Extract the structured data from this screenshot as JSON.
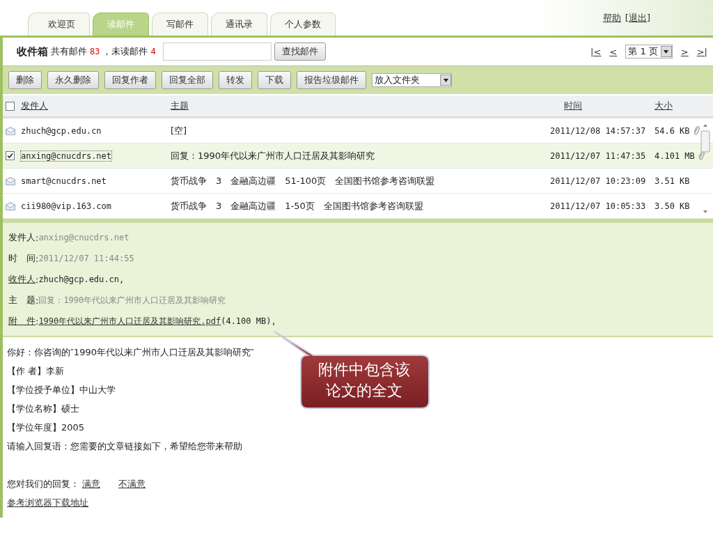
{
  "tabs": [
    {
      "label": "欢迎页",
      "selected": false
    },
    {
      "label": "读邮件",
      "selected": true
    },
    {
      "label": "写邮件",
      "selected": false
    },
    {
      "label": "通讯录",
      "selected": false
    },
    {
      "label": "个人参数",
      "selected": false
    }
  ],
  "top_links": {
    "help": "帮助",
    "logout": "[退出]"
  },
  "inbox": {
    "folder": "收件箱",
    "total_label": "共有邮件",
    "total": "83",
    "unread_label": "，未读邮件",
    "unread": "4",
    "search_button": "查找邮件"
  },
  "pager": {
    "first": "|<",
    "prev": "<",
    "page": "第 1 页",
    "next": ">",
    "last": ">|"
  },
  "toolbar": {
    "buttons": [
      "删除",
      "永久删除",
      "回复作者",
      "回复全部",
      "转发",
      "下载",
      "报告垃圾邮件"
    ],
    "folder_select": "放入文件夹"
  },
  "table": {
    "select_all": false,
    "columns": [
      "发件人",
      "主题",
      "时间",
      "大小"
    ],
    "rows": [
      {
        "sender": "zhuch@gcp.edu.cn",
        "subject": "[空]",
        "time": "2011/12/08 14:57:37",
        "size": "54.6 KB",
        "attachment": true,
        "selected": false
      },
      {
        "sender": "anxing@cnucdrs.net",
        "subject": "回复：1990年代以来广州市人口迁居及其影响研究",
        "time": "2011/12/07 11:47:35",
        "size": "4.101 MB",
        "attachment": true,
        "selected": true
      },
      {
        "sender": "smart@cnucdrs.net",
        "subject": "货币战争　3　金融高边疆　51-100页　全国图书馆参考咨询联盟",
        "time": "2011/12/07 10:23:09",
        "size": "3.51 KB",
        "attachment": false,
        "selected": false
      },
      {
        "sender": "cii980@vip.163.com",
        "subject": "货币战争　3　金融高边疆　1-50页　全国图书馆参考咨询联盟",
        "time": "2011/12/07 10:05:33",
        "size": "3.50 KB",
        "attachment": false,
        "selected": false
      }
    ]
  },
  "preview": {
    "separator": ":",
    "fields": [
      {
        "label": "发件人",
        "label_link": false,
        "value": "anxing@cnucdrs.net",
        "muted": true
      },
      {
        "label": "时　间",
        "label_link": false,
        "value": "2011/12/07 11:44:55",
        "muted": true
      },
      {
        "label": "收件人",
        "label_link": true,
        "value": "zhuch@gcp.edu.cn,",
        "muted": false
      },
      {
        "label": "主　题",
        "label_link": false,
        "value": "回复：1990年代以来广州市人口迁居及其影响研究",
        "muted": true
      },
      {
        "label": "附　件",
        "label_link": true,
        "file": "1990年代以来广州市人口迁居及其影响研究.pdf",
        "value": "(4.100 MB),",
        "muted": false
      }
    ]
  },
  "body": {
    "lines": [
      "你好：你咨询的″1990年代以来广州市人口迁居及其影响研究″",
      "【作 者】李新",
      "【学位授予单位】中山大学",
      "【学位名称】硕士",
      "【学位年度】2005",
      "请输入回复语：您需要的文章链接如下，希望给您带来帮助"
    ],
    "rating_label": "您对我们的回复：",
    "rating_links": [
      "满意",
      "不满意"
    ],
    "download_link": "参考浏览器下载地址"
  },
  "callout": {
    "lines": [
      "附件中包含该",
      "论文的全文"
    ]
  }
}
